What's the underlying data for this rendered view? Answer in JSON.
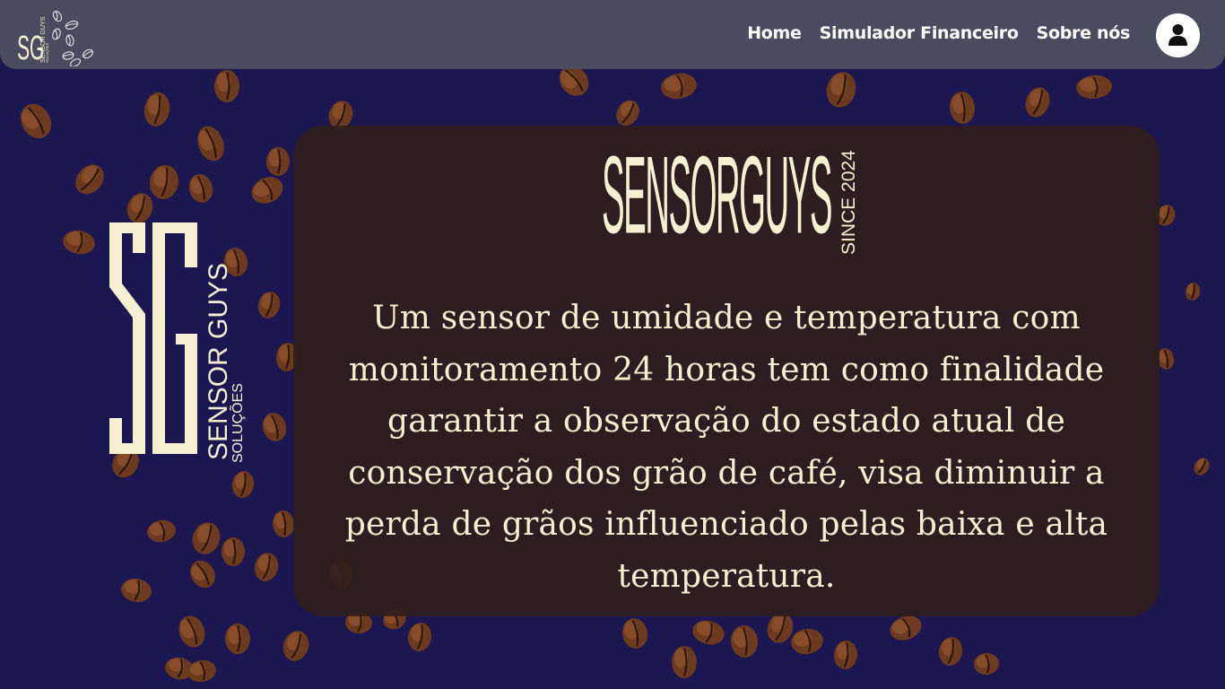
{
  "colors": {
    "background": "#1c1750",
    "navbar": "#4a4b5e",
    "card": "#301e1c",
    "cream": "#f6f0d2",
    "bean": "#6b3a1f"
  },
  "navbar": {
    "logo": {
      "initials": "SG",
      "text": "SENSOR GUYS",
      "subtext": "SOLUÇÕES",
      "icon": "coffee-beans-icon"
    },
    "links": [
      {
        "label": "Home"
      },
      {
        "label": "Simulador Financeiro"
      },
      {
        "label": "Sobre nós"
      }
    ],
    "profile_icon": "user-icon"
  },
  "side_logo": {
    "initials": "SG",
    "name": "SENSOR GUYS",
    "tagline": "SOLUÇÕES"
  },
  "card": {
    "brand": "SENSORGUYS",
    "since": "SINCE 2024",
    "description": "Um sensor de umidade e temperatura com monitoramento 24 horas tem como finalidade garantir a observação do estado atual de conservação dos grão de café, visa diminuir a perda de grãos influenciado pelas baixa e alta temperatura."
  }
}
